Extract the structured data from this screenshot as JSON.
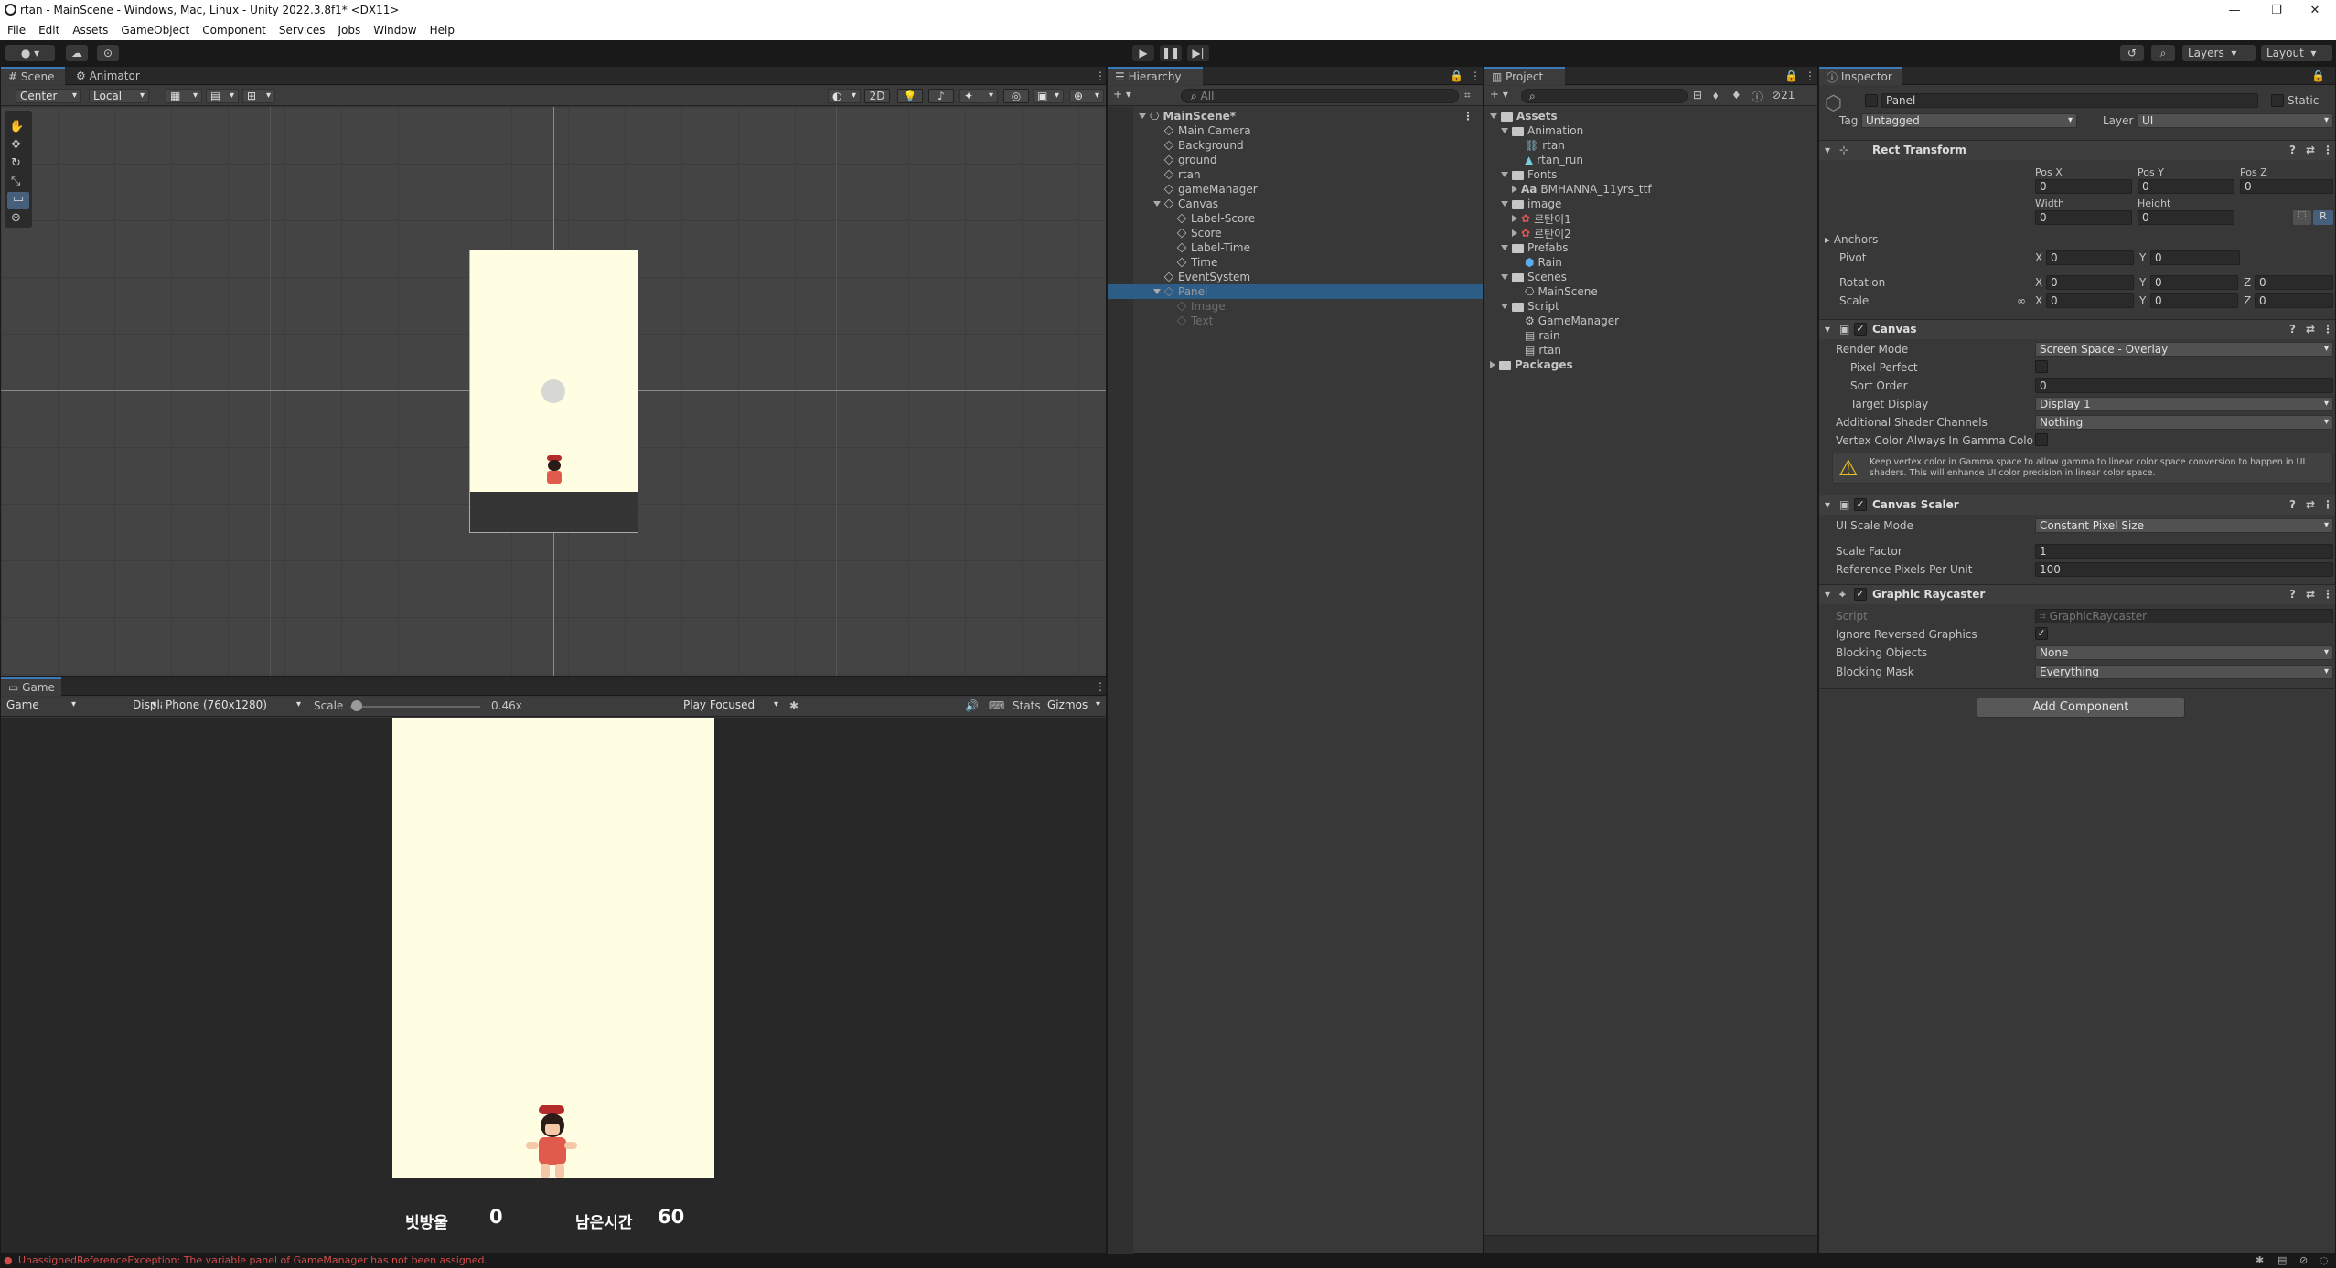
{
  "window": {
    "title": "rtan - MainScene - Windows, Mac, Linux - Unity 2022.3.8f1* <DX11>"
  },
  "menu": [
    "File",
    "Edit",
    "Assets",
    "GameObject",
    "Component",
    "Services",
    "Jobs",
    "Window",
    "Help"
  ],
  "toolbar": {
    "layers": "Layers",
    "layout": "Layout"
  },
  "scene": {
    "tabs": [
      "Scene",
      "Animator"
    ],
    "pivot": "Center",
    "space": "Local",
    "mode2d": "2D"
  },
  "game": {
    "tab": "Game",
    "view": "Game",
    "display": "Display 1",
    "resolution": "Phone (760x1280)",
    "scale_label": "Scale",
    "scale_value": "0.46x",
    "scale_level": 0.05,
    "play_mode": "Play Focused",
    "stats": "Stats",
    "gizmos": "Gizmos",
    "hud": {
      "score_label": "빗방울",
      "score": "0",
      "time_label": "남은시간",
      "time": "60"
    }
  },
  "hierarchy": {
    "tab": "Hierarchy",
    "search_placeholder": "All",
    "items": [
      {
        "label": "MainScene*",
        "level": 0
      },
      {
        "label": "Main Camera",
        "level": 1
      },
      {
        "label": "Background",
        "level": 1
      },
      {
        "label": "ground",
        "level": 1
      },
      {
        "label": "rtan",
        "level": 1
      },
      {
        "label": "gameManager",
        "level": 1
      },
      {
        "label": "Canvas",
        "level": 1
      },
      {
        "label": "Label-Score",
        "level": 2
      },
      {
        "label": "Score",
        "level": 2
      },
      {
        "label": "Label-Time",
        "level": 2
      },
      {
        "label": "Time",
        "level": 2
      },
      {
        "label": "EventSystem",
        "level": 1
      },
      {
        "label": "Panel",
        "level": 1
      },
      {
        "label": "Image",
        "level": 2
      },
      {
        "label": "Text",
        "level": 2
      }
    ]
  },
  "project": {
    "tab": "Project",
    "hidden_count": "21",
    "items": [
      {
        "label": "Assets",
        "level": 0
      },
      {
        "label": "Animation",
        "level": 1
      },
      {
        "label": "rtan",
        "level": 2
      },
      {
        "label": "rtan_run",
        "level": 2
      },
      {
        "label": "Fonts",
        "level": 1
      },
      {
        "label": "BMHANNA_11yrs_ttf",
        "level": 2
      },
      {
        "label": "image",
        "level": 1
      },
      {
        "label": "르탄이1",
        "level": 2
      },
      {
        "label": "르탄이2",
        "level": 2
      },
      {
        "label": "Prefabs",
        "level": 1
      },
      {
        "label": "Rain",
        "level": 2
      },
      {
        "label": "Scenes",
        "level": 1
      },
      {
        "label": "MainScene",
        "level": 2
      },
      {
        "label": "Script",
        "level": 1
      },
      {
        "label": "GameManager",
        "level": 2
      },
      {
        "label": "rain",
        "level": 2
      },
      {
        "label": "rtan",
        "level": 2
      },
      {
        "label": "Packages",
        "level": 0
      }
    ]
  },
  "inspector": {
    "tab": "Inspector",
    "object_name": "Panel",
    "static_label": "Static",
    "tag_label": "Tag",
    "tag": "Untagged",
    "layer_label": "Layer",
    "layer": "UI",
    "rect": {
      "title": "Rect Transform",
      "posx_label": "Pos X",
      "posy_label": "Pos Y",
      "posz_label": "Pos Z",
      "posx": "0",
      "posy": "0",
      "posz": "0",
      "width_label": "Width",
      "height_label": "Height",
      "width": "0",
      "height": "0",
      "anchors": "Anchors",
      "pivot": "Pivot",
      "pivot_x": "0",
      "pivot_y": "0",
      "rotation": "Rotation",
      "rot_x": "0",
      "rot_y": "0",
      "rot_z": "0",
      "scale": "Scale",
      "scale_x": "0",
      "scale_y": "0",
      "scale_z": "0",
      "x": "X",
      "y": "Y",
      "z": "Z",
      "r_btn": "R"
    },
    "canvas": {
      "title": "Canvas",
      "render_mode_label": "Render Mode",
      "render_mode": "Screen Space - Overlay",
      "pixel_perfect": "Pixel Perfect",
      "sort_order_label": "Sort Order",
      "sort_order": "0",
      "target_display_label": "Target Display",
      "target_display": "Display 1",
      "shader_label": "Additional Shader Channels",
      "shader": "Nothing",
      "vertex_label": "Vertex Color Always In Gamma Color S",
      "warning": "Keep vertex color in Gamma space to allow gamma to linear color space conversion to happen in UI shaders. This will enhance UI color precision in linear color space."
    },
    "scaler": {
      "title": "Canvas Scaler",
      "mode_label": "UI Scale Mode",
      "mode": "Constant Pixel Size",
      "factor_label": "Scale Factor",
      "factor": "1",
      "ppu_label": "Reference Pixels Per Unit",
      "ppu": "100"
    },
    "raycaster": {
      "title": "Graphic Raycaster",
      "script_label": "Script",
      "script": "GraphicRaycaster",
      "ignore_label": "Ignore Reversed Graphics",
      "blocking_label": "Blocking Objects",
      "blocking": "None",
      "mask_label": "Blocking Mask",
      "mask": "Everything"
    },
    "add_component": "Add Component"
  },
  "status": {
    "error": "UnassignedReferenceException: The variable panel of GameManager has not been assigned."
  },
  "colors": {
    "accent": "#3a79bb",
    "selection": "#2c5d87",
    "error": "#d44a4a",
    "game_bg": "#fffee2"
  }
}
